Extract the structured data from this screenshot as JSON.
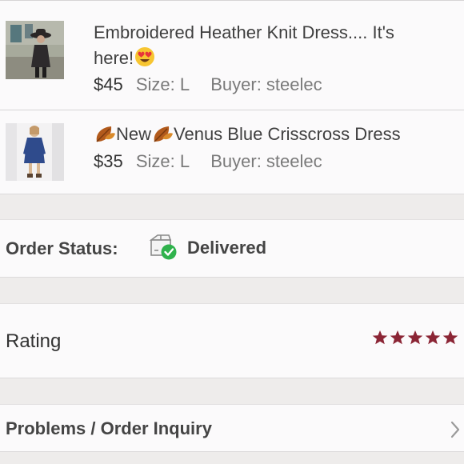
{
  "items": [
    {
      "title_text": "Embroidered Heather Knit Dress.... It's here!",
      "title_line1": "Embroidered Heather Knit Dress.... It's",
      "title_line2": "here!",
      "title_emoji": "heart-eyes-emoji",
      "price": "$45",
      "size": "Size: L",
      "buyer": "Buyer: steelec",
      "thumbnail": "photo of woman in dark knit dress and hat"
    },
    {
      "title_prefix": "New",
      "title_main": "Venus Blue Crisscross Dress",
      "title_emoji": "fallen-leaf-emoji",
      "price": "$35",
      "size": "Size: L",
      "buyer": "Buyer: steelec",
      "thumbnail": "photo of woman in blue dress"
    }
  ],
  "order_status": {
    "label": "Order Status:",
    "value": "Delivered",
    "icon": "package-delivered-icon",
    "icon_check_color": "#2fb24c"
  },
  "rating": {
    "label": "Rating",
    "stars": 5,
    "max_stars": 5,
    "star_color": "#8b2535"
  },
  "problems": {
    "label": "Problems / Order Inquiry",
    "icon": "chevron-right-icon"
  }
}
